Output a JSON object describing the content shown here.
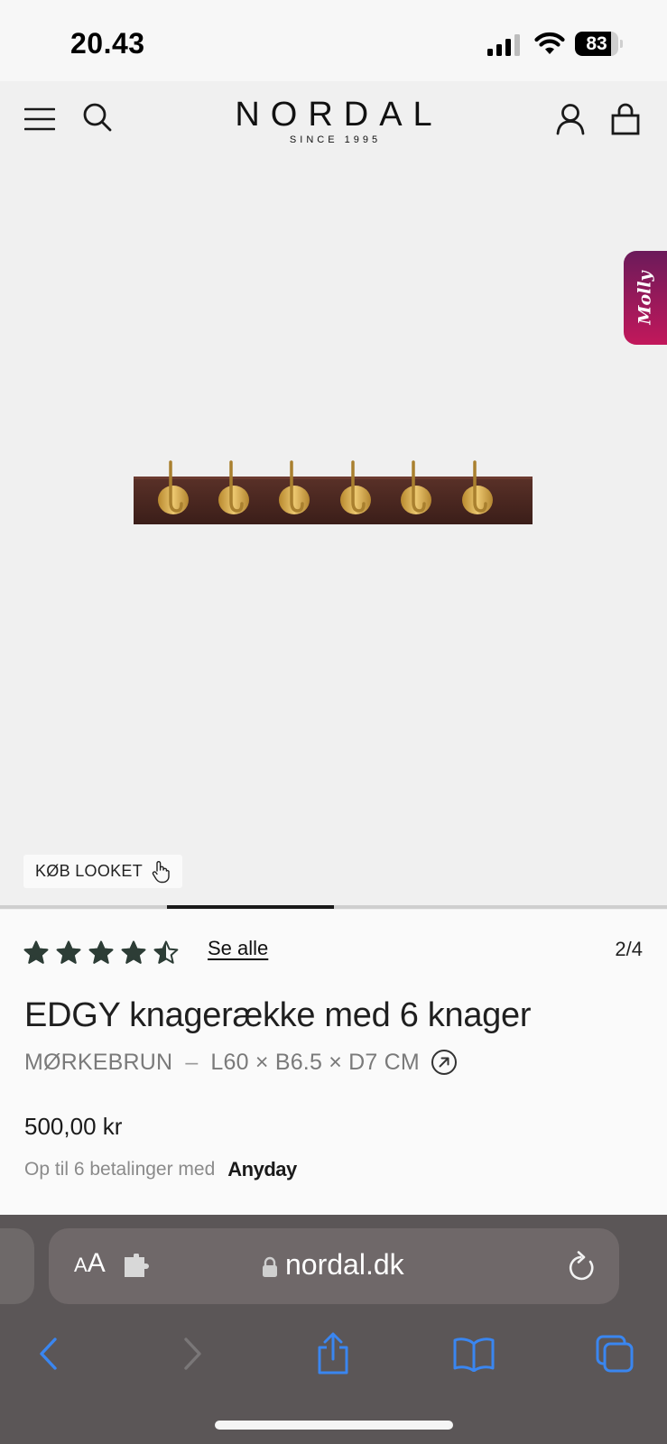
{
  "status_bar": {
    "time": "20.43",
    "battery_level": "83",
    "battery_fraction": 0.83
  },
  "header": {
    "brand_name": "NORDAL",
    "brand_tagline": "SINCE 1995"
  },
  "gallery": {
    "chat_widget_label": "Molly",
    "buy_look_label": "KØB LOOKET",
    "current_image": 2,
    "total_images": 4
  },
  "product": {
    "rating_value": 4.5,
    "rating_max": 5,
    "see_all_label": "Se alle",
    "image_counter": "2/4",
    "title": "EDGY knagerække med 6 knager",
    "color": "MØRKEBRUN",
    "dimensions": "L60 × B6.5 × D7 CM",
    "separator": "–",
    "price": "500,00 kr",
    "installments_text": "Op til 6 betalinger med",
    "installments_provider": "Anyday"
  },
  "browser": {
    "text_size_small": "A",
    "text_size_big": "A",
    "url": "nordal.dk"
  },
  "colors": {
    "accent_dark_green": "#2d3d36",
    "rack_wood": "#4a2620",
    "hook_brass": "#c9a24a",
    "safari_blue": "#3a86f0"
  }
}
